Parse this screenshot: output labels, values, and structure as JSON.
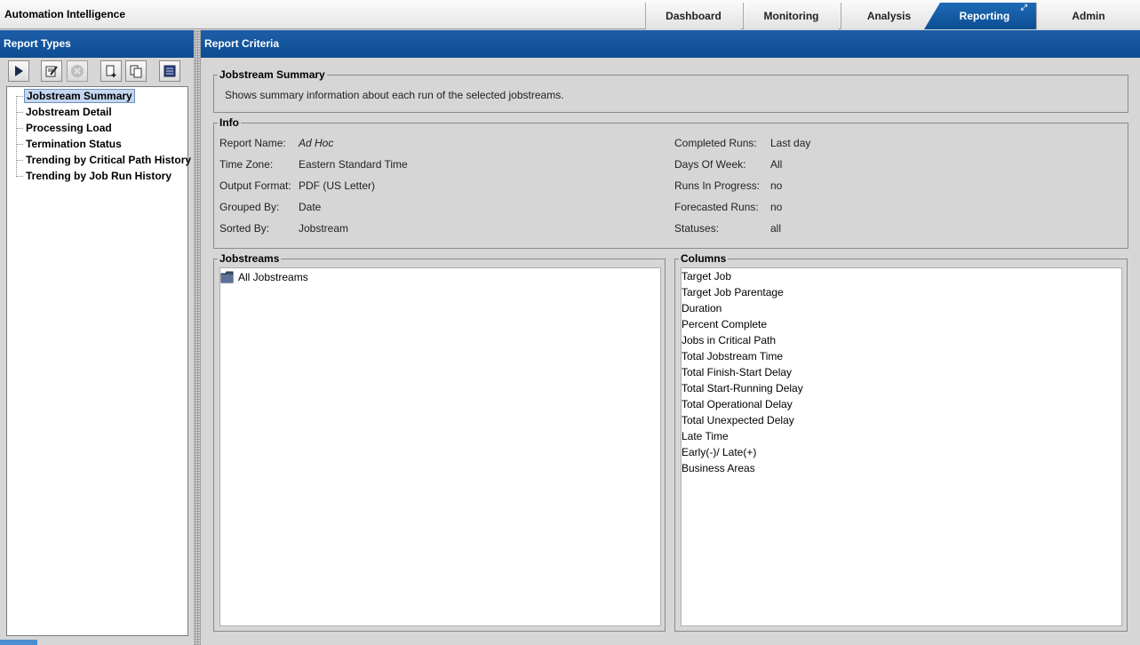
{
  "app": {
    "title": "Automation Intelligence"
  },
  "nav": {
    "tabs": [
      {
        "label": "Dashboard",
        "active": false
      },
      {
        "label": "Monitoring",
        "active": false
      },
      {
        "label": "Analysis",
        "active": false
      },
      {
        "label": "Reporting",
        "active": true
      },
      {
        "label": "Admin",
        "active": false
      }
    ]
  },
  "left": {
    "header": "Report Types",
    "toolbar": [
      {
        "icon": "play-icon"
      },
      {
        "icon": "edit-icon"
      },
      {
        "icon": "cancel-icon",
        "disabled": true
      },
      {
        "icon": "new-report-icon"
      },
      {
        "icon": "copy-icon"
      },
      {
        "icon": "list-icon"
      }
    ],
    "tree": [
      {
        "label": "Jobstream Summary",
        "selected": true
      },
      {
        "label": "Jobstream Detail"
      },
      {
        "label": "Processing Load"
      },
      {
        "label": "Termination Status"
      },
      {
        "label": "Trending by Critical Path History"
      },
      {
        "label": "Trending by Job Run History"
      }
    ]
  },
  "right": {
    "header": "Report Criteria",
    "summary": {
      "title": "Jobstream Summary",
      "description": "Shows summary information about each run of the selected jobstreams."
    },
    "info": {
      "title": "Info",
      "left": [
        {
          "label": "Report Name:",
          "value": "Ad Hoc",
          "italic": true
        },
        {
          "label": "Time Zone:",
          "value": "Eastern Standard Time"
        },
        {
          "label": "Output Format:",
          "value": "PDF (US Letter)"
        },
        {
          "label": "Grouped By:",
          "value": "Date"
        },
        {
          "label": "Sorted By:",
          "value": "Jobstream"
        }
      ],
      "right": [
        {
          "label": "Completed Runs:",
          "value": "Last day"
        },
        {
          "label": "Days Of Week:",
          "value": "All"
        },
        {
          "label": "Runs In Progress:",
          "value": "no"
        },
        {
          "label": "Forecasted Runs:",
          "value": "no"
        },
        {
          "label": "Statuses:",
          "value": "all"
        }
      ]
    },
    "jobstreams": {
      "title": "Jobstreams",
      "items": [
        {
          "label": "All Jobstreams",
          "icon": "folder-icon"
        }
      ]
    },
    "columns": {
      "title": "Columns",
      "items": [
        "Target Job",
        "Target Job Parentage",
        "Duration",
        "Percent Complete",
        "Jobs in Critical Path",
        "Total Jobstream Time",
        "Total Finish-Start Delay",
        "Total Start-Running Delay",
        "Total Operational Delay",
        "Total Unexpected Delay",
        "Late Time",
        "Early(-)/ Late(+)",
        "Business Areas"
      ]
    }
  },
  "colors": {
    "header_blue": "#0c4d93",
    "panel_gray": "#d6d6d6",
    "selection": "#c5d7ef"
  }
}
